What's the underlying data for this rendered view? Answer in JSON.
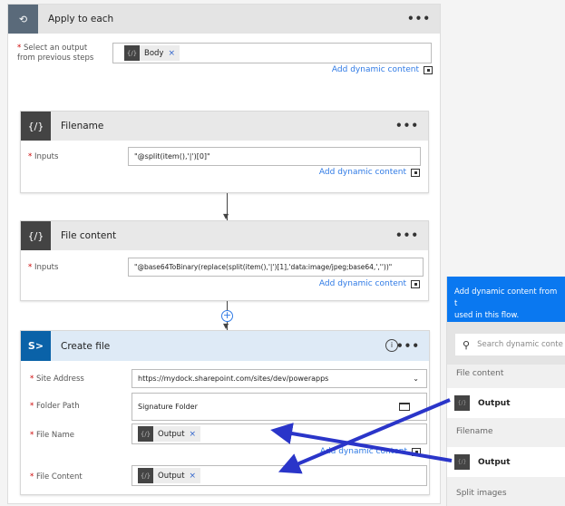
{
  "apply": {
    "title": "Apply to each",
    "label_line1": "Select an output",
    "label_line2": "from previous steps",
    "token": "Body",
    "add_dynamic": "Add dynamic content"
  },
  "filename": {
    "title": "Filename",
    "label": "Inputs",
    "value": "\"@split(item(),'|')[0]\"",
    "add_dynamic": "Add dynamic content"
  },
  "filecontent": {
    "title": "File content",
    "label": "Inputs",
    "value": "\"@base64ToBinary(replace(split(item(),'|')[1],'data:image/jpeg;base64,',''))\"",
    "add_dynamic": "Add dynamic content"
  },
  "createfile": {
    "title": "Create file",
    "site_label": "Site Address",
    "site_value": "https://mydock.sharepoint.com/sites/dev/powerapps",
    "folder_label": "Folder Path",
    "folder_value": "Signature Folder",
    "name_label": "File Name",
    "name_token": "Output",
    "content_label": "File Content",
    "content_token": "Output",
    "add_dynamic": "Add dynamic content"
  },
  "panel": {
    "header_line1": "Add dynamic content from t",
    "header_line2": "used in this flow.",
    "search_placeholder": "Search dynamic conte",
    "sections": [
      {
        "title": "File content",
        "item": "Output"
      },
      {
        "title": "Filename",
        "item": "Output"
      },
      {
        "title": "Split images"
      }
    ]
  },
  "colors": {
    "accent": "#2f7ae5",
    "panel_header": "#0a78f0",
    "arrow": "#2a35c9",
    "sharepoint": "#0a62a8"
  }
}
